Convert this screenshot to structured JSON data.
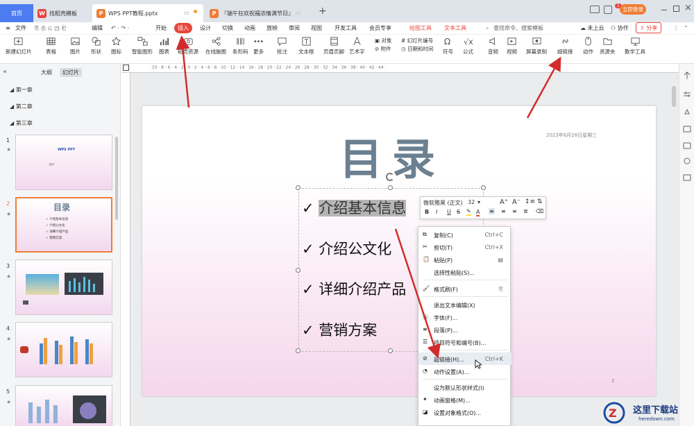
{
  "tabs": {
    "home": "首页",
    "template": "找稻壳模板",
    "doc": "WPS PPT教程.pptx",
    "promo": "『端午狂欢祝福浓情满节日』",
    "add": "+"
  },
  "window": {
    "badge": "1",
    "login": "立即登录"
  },
  "menu": {
    "file": "文件",
    "edit": "编辑",
    "items": [
      "开始",
      "插入",
      "设计",
      "切换",
      "动画",
      "放映",
      "审阅",
      "视图",
      "开发工具",
      "会员专享"
    ],
    "context_tabs": [
      "绘图工具",
      "文本工具"
    ],
    "search": "查找命令、搜索模板",
    "cloud": "未上云",
    "collab": "协作",
    "share": "分享"
  },
  "ribbon": {
    "buttons": [
      "新建幻灯片",
      "表格",
      "图片",
      "形状",
      "图标",
      "智能图形",
      "图表",
      "稻壳资源",
      "在线脑图",
      "条形码",
      "更多",
      "批注",
      "文本框",
      "页眉页脚",
      "艺术字",
      "附件",
      "符号",
      "公式",
      "音频",
      "视频",
      "屏幕录制",
      "超链接",
      "动作",
      "资源夹",
      "教学工具"
    ],
    "small": [
      "对象",
      "幻灯片编号",
      "日期和时间"
    ]
  },
  "panel": {
    "tab_outline": "大纲",
    "tab_slides": "幻灯片",
    "sections": [
      "第一章",
      "第二章",
      "第三章"
    ],
    "slides": [
      "1",
      "2",
      "3",
      "4",
      "5"
    ],
    "star": "★",
    "slide1_title": "WPS PPT",
    "slide1_sub": "PPT",
    "slide2_title": "目录",
    "slide2_items": [
      "✓ 介绍基本信息",
      "✓ 介绍公文化",
      "✓ 详细介绍产品",
      "✓ 营销方案"
    ]
  },
  "ruler": {
    "marks": "· 10 · 8 · 6 · 4 · 2 · 0 · 2 · 4 · 6 · 8 · 10 · 12 · 14 · 16 · 18 · 20 · 22 · 24 · 26 · 28 · 30 · 32 · 34 · 36 · 38 · 40 · 42 · 44 ·"
  },
  "slide": {
    "title": "目录",
    "date": "2023年6月28日星期三",
    "items": [
      "介绍基本信息",
      "介绍公文化",
      "详细介绍产品",
      "营销方案"
    ],
    "check": "✓",
    "page": "2"
  },
  "mini_toolbar": {
    "font": "微软雅黑 (正文)",
    "size": "32",
    "bold": "B",
    "italic": "I",
    "underline": "U",
    "strike": "S",
    "grow": "A⁺",
    "shrink": "A⁻",
    "font_color": "A"
  },
  "context_menu": [
    {
      "label": "复制(C)",
      "shortcut": "Ctrl+C"
    },
    {
      "label": "剪切(T)",
      "shortcut": "Ctrl+X"
    },
    {
      "label": "粘贴(P)",
      "shortcut": ""
    },
    {
      "label": "选择性粘贴(S)...",
      "shortcut": ""
    },
    {
      "label": "格式刷(F)",
      "shortcut": ""
    },
    {
      "label": "退出文本编辑(X)",
      "shortcut": ""
    },
    {
      "label": "字体(F)...",
      "shortcut": ""
    },
    {
      "label": "段落(P)...",
      "shortcut": ""
    },
    {
      "label": "项目符号和编号(B)...",
      "shortcut": ""
    },
    {
      "label": "超链接(H)...",
      "shortcut": "Ctrl+K"
    },
    {
      "label": "动作设置(A)...",
      "shortcut": ""
    },
    {
      "label": "设为默认形状样式(I)",
      "shortcut": ""
    },
    {
      "label": "动画窗格(M)...",
      "shortcut": ""
    },
    {
      "label": "设置对象格式(O)...",
      "shortcut": ""
    }
  ],
  "watermark": {
    "title": "这里下载站",
    "url": "heredown.com"
  },
  "colors": {
    "accent": "#e8453c",
    "title": "#6b8091",
    "highlight": "#b5b5b5",
    "arrow": "#d22b2b"
  }
}
